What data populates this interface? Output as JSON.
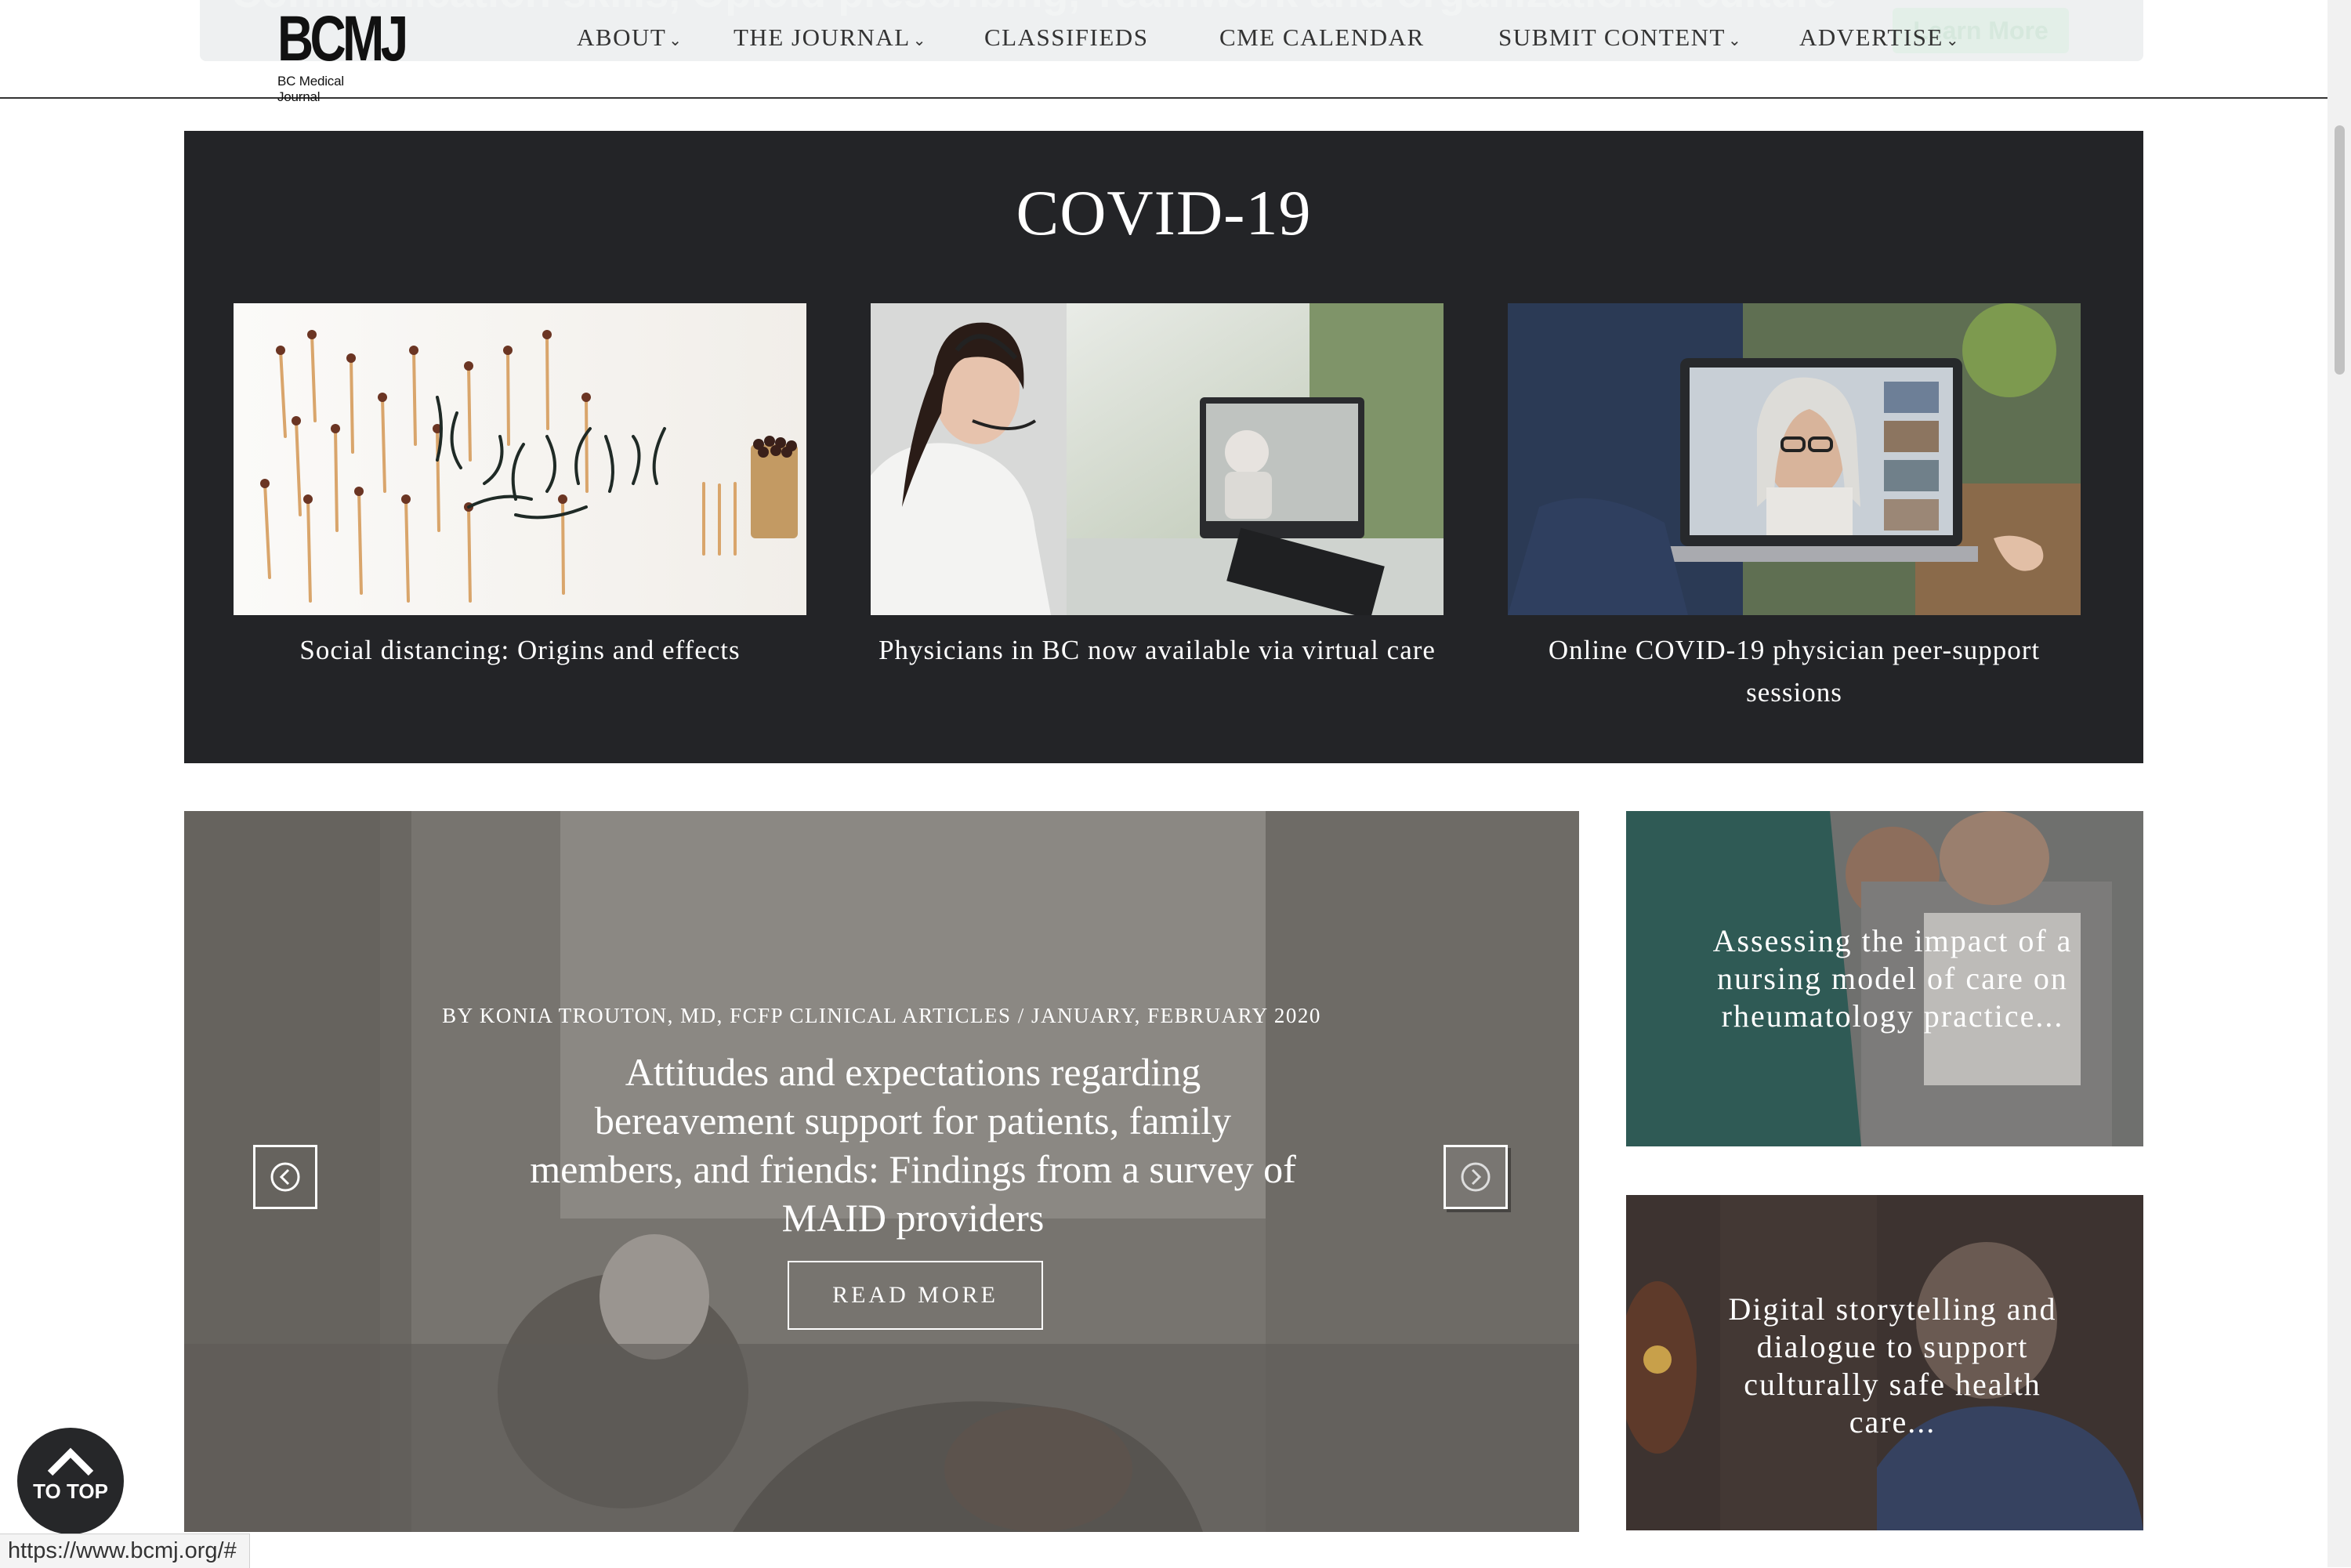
{
  "banner": {
    "text": "Communication skills, Opioid prescribing, Teamwork and organizational culture",
    "button_label": "Learn More"
  },
  "header": {
    "logo_main": "BCMJ",
    "logo_sub": "BC Medical Journal",
    "nav": [
      {
        "label": "ABOUT",
        "dropdown": true
      },
      {
        "label": "THE JOURNAL",
        "dropdown": true
      },
      {
        "label": "CLASSIFIEDS",
        "dropdown": false
      },
      {
        "label": "CME CALENDAR",
        "dropdown": false
      },
      {
        "label": "SUBMIT CONTENT",
        "dropdown": true
      },
      {
        "label": "ADVERTISE",
        "dropdown": true
      }
    ],
    "chevron_glyph": "⌄"
  },
  "covid": {
    "title": "COVID-19",
    "cards": [
      {
        "caption": "Social distancing: Origins and effects",
        "image": "burnt-matches-image"
      },
      {
        "caption": "Physicians in BC now available via virtual care",
        "image": "virtual-care-doctor-image"
      },
      {
        "caption": "Online COVID-19 physician peer-support sessions",
        "image": "video-call-laptop-image"
      }
    ]
  },
  "hero": {
    "meta": "BY KONIA TROUTON, MD, FCFP CLINICAL ARTICLES /  JANUARY, FEBRUARY 2020",
    "title": "Attitudes and expectations regarding bereavement support for patients, family members, and friends: Findings from a survey of MAID providers",
    "read_more": "READ MORE",
    "prev_icon": "chevron-left-circle-icon",
    "next_icon": "chevron-right-circle-icon"
  },
  "side_cards": [
    {
      "text": "Assessing the impact of a nursing model of care on rheumatology practice..."
    },
    {
      "text": "Digital storytelling and dialogue to support culturally safe health care..."
    }
  ],
  "to_top": {
    "label": "TO TOP",
    "icon": "chevron-up-icon"
  },
  "status_bar": {
    "url": "https://www.bcmj.org/#"
  },
  "colors": {
    "section_dark": "#232427",
    "header_border": "#333333",
    "text_light": "#ffffff"
  }
}
